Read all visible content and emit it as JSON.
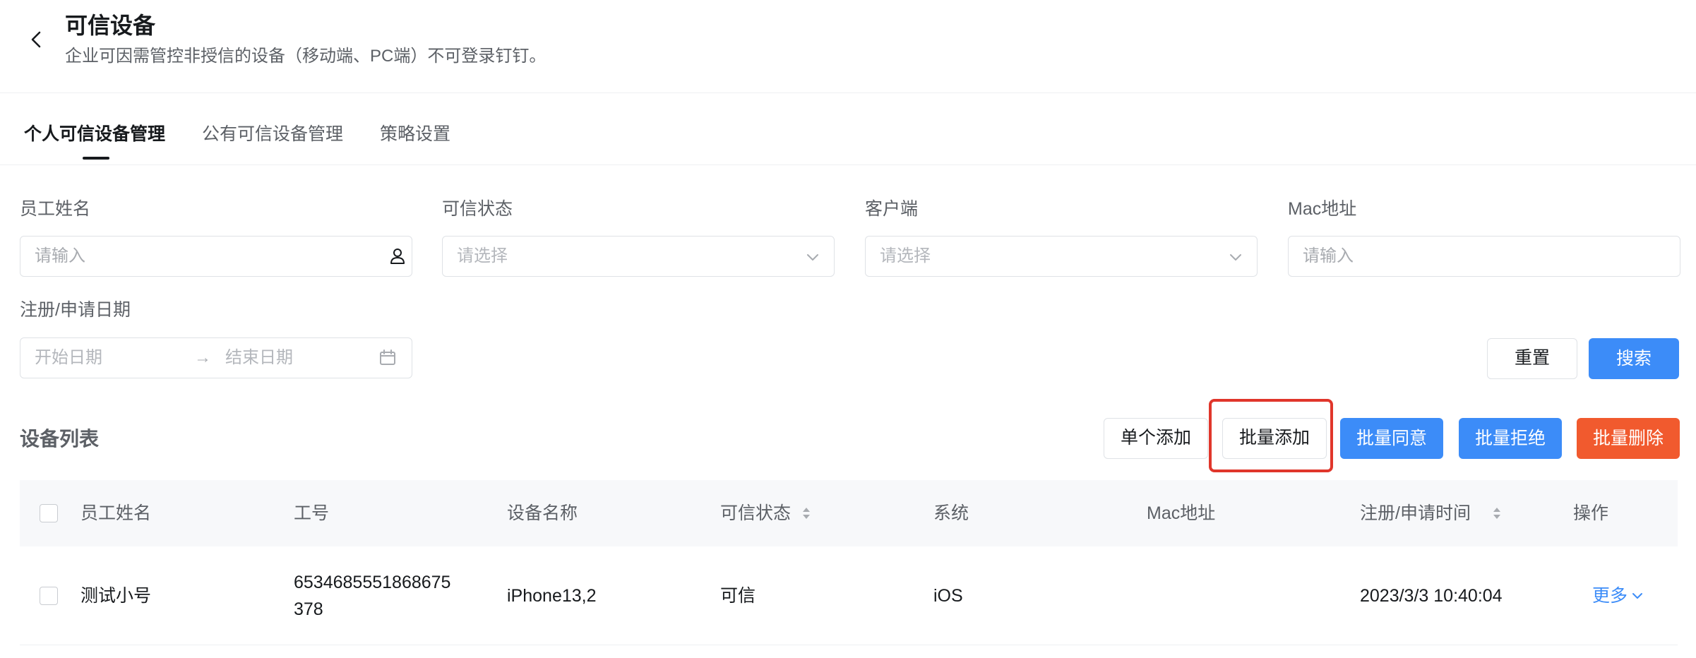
{
  "header": {
    "title": "可信设备",
    "description": "企业可因需管控非授信的设备（移动端、PC端）不可登录钉钉。"
  },
  "tabs": [
    {
      "label": "个人可信设备管理",
      "active": true
    },
    {
      "label": "公有可信设备管理",
      "active": false
    },
    {
      "label": "策略设置",
      "active": false
    }
  ],
  "filters": {
    "employee_name": {
      "label": "员工姓名",
      "placeholder": "请输入"
    },
    "trust_status": {
      "label": "可信状态",
      "placeholder": "请选择"
    },
    "client": {
      "label": "客户端",
      "placeholder": "请选择"
    },
    "mac": {
      "label": "Mac地址",
      "placeholder": "请输入"
    },
    "date": {
      "label": "注册/申请日期",
      "start_placeholder": "开始日期",
      "separator": "→",
      "end_placeholder": "结束日期"
    }
  },
  "actions": {
    "reset": "重置",
    "search": "搜索"
  },
  "device_list": {
    "title": "设备列表",
    "buttons": {
      "single_add": "单个添加",
      "batch_add": "批量添加",
      "batch_approve": "批量同意",
      "batch_reject": "批量拒绝",
      "batch_delete": "批量删除"
    },
    "columns": [
      "员工姓名",
      "工号",
      "设备名称",
      "可信状态",
      "系统",
      "Mac地址",
      "注册/申请时间",
      "操作"
    ],
    "rows": [
      {
        "name": "测试小号",
        "job_no_line1": "6534685551868675",
        "job_no_line2": "378",
        "device": "iPhone13,2",
        "status": "可信",
        "os": "iOS",
        "mac": "",
        "time": "2023/3/3 10:40:04",
        "action": "更多"
      }
    ]
  },
  "colors": {
    "primary": "#3c8cf8",
    "danger": "#f15a2e",
    "highlight": "#e0362b"
  }
}
